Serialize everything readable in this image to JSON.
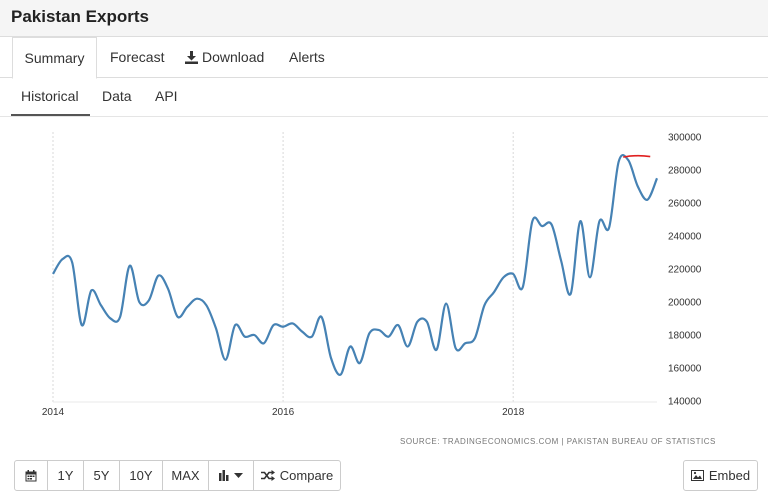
{
  "header": {
    "title": "Pakistan Exports"
  },
  "tabs": [
    {
      "label": "Summary"
    },
    {
      "label": "Forecast"
    },
    {
      "label": "Download"
    },
    {
      "label": "Alerts"
    }
  ],
  "subtabs": [
    {
      "label": "Historical"
    },
    {
      "label": "Data"
    },
    {
      "label": "API"
    }
  ],
  "source": "SOURCE: TRADINGECONOMICS.COM  |  PAKISTAN BUREAU OF STATISTICS",
  "toolbar": {
    "ranges": [
      "1Y",
      "5Y",
      "10Y",
      "MAX"
    ],
    "compare_label": "Compare",
    "embed_label": "Embed"
  },
  "icons": {
    "calendar": "calendar-icon",
    "chart_type": "bar-chart-icon",
    "compare": "shuffle-icon",
    "download": "download-icon",
    "embed": "image-icon"
  },
  "colors": {
    "line": "#4682b4",
    "highlight": "#e02020"
  },
  "chart_data": {
    "type": "line",
    "title": "",
    "xlabel": "",
    "ylabel": "",
    "x_ticks": [
      "2014",
      "2016",
      "2018"
    ],
    "y_ticks": [
      "140000",
      "160000",
      "180000",
      "200000",
      "220000",
      "240000",
      "260000",
      "280000",
      "300000"
    ],
    "ylim": [
      140000,
      300000
    ],
    "grid": "vertical dotted",
    "series": [
      {
        "x": [
          "2014-01",
          "2014-02",
          "2014-03",
          "2014-04",
          "2014-05",
          "2014-06",
          "2014-07",
          "2014-08",
          "2014-09",
          "2014-10",
          "2014-11",
          "2014-12",
          "2015-01",
          "2015-02",
          "2015-03",
          "2015-04",
          "2015-05",
          "2015-06",
          "2015-07",
          "2015-08",
          "2015-09",
          "2015-10",
          "2015-11",
          "2015-12",
          "2016-01",
          "2016-02",
          "2016-03",
          "2016-04",
          "2016-05",
          "2016-06",
          "2016-07",
          "2016-08",
          "2016-09",
          "2016-10",
          "2016-11",
          "2016-12",
          "2017-01",
          "2017-02",
          "2017-03",
          "2017-04",
          "2017-05",
          "2017-06",
          "2017-07",
          "2017-08",
          "2017-09",
          "2017-10",
          "2017-11",
          "2017-12",
          "2018-01",
          "2018-02",
          "2018-03",
          "2018-04",
          "2018-05",
          "2018-06",
          "2018-07",
          "2018-08",
          "2018-09",
          "2018-10",
          "2018-11",
          "2018-12",
          "2019-01",
          "2019-02",
          "2019-03",
          "2019-04"
        ],
        "values": [
          217000,
          226000,
          224000,
          186000,
          207000,
          198000,
          190000,
          191000,
          222000,
          200000,
          201000,
          216000,
          208000,
          191000,
          197000,
          202000,
          198000,
          184000,
          165000,
          186000,
          179000,
          180000,
          175000,
          186000,
          185000,
          187000,
          182000,
          179000,
          191000,
          166000,
          156000,
          173000,
          163000,
          181000,
          183000,
          179000,
          186000,
          173000,
          188000,
          188000,
          171000,
          199000,
          172000,
          175000,
          178000,
          198000,
          206000,
          215000,
          217000,
          209000,
          249000,
          246000,
          247000,
          225000,
          205000,
          249000,
          215000,
          249000,
          245000,
          285000,
          286000,
          270000,
          262000,
          275000
        ]
      }
    ],
    "annotation": {
      "type": "highlight-mark",
      "near": "peak",
      "color": "#e02020"
    }
  }
}
